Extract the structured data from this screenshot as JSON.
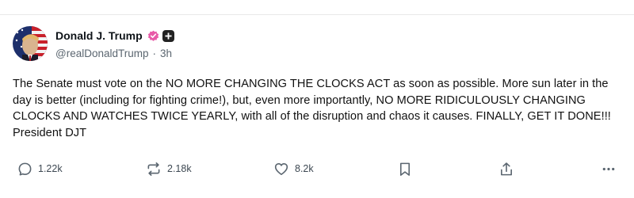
{
  "post": {
    "author": {
      "display_name": "Donald J. Trump",
      "handle": "@realDonaldTrump",
      "separator": "·",
      "time_ago": "3h",
      "avatar": "avatar-photo-flag-portrait",
      "verified_badge": "verified-badge-icon",
      "plus_badge": "plus-badge-icon"
    },
    "text": "The Senate must vote on the NO MORE CHANGING THE CLOCKS ACT as soon as possible. More sun later in the day is better (including for fighting crime!), but, even more importantly, NO MORE RIDICULOUSLY CHANGING CLOCKS AND WATCHES TWICE YEARLY, with all of the disruption and chaos it causes. FINALLY, GET IT DONE!!! President DJT",
    "actions": {
      "reply": {
        "icon": "reply-icon",
        "count": "1.22k"
      },
      "repost": {
        "icon": "repost-icon",
        "count": "2.18k"
      },
      "like": {
        "icon": "heart-icon",
        "count": "8.2k"
      },
      "bookmark": {
        "icon": "bookmark-icon"
      },
      "share": {
        "icon": "share-icon"
      },
      "more": {
        "icon": "more-icon"
      }
    }
  },
  "colors": {
    "verified": "#e85ba8",
    "text": "#0f1419",
    "muted": "#5b6670",
    "icon": "#5b6670"
  }
}
